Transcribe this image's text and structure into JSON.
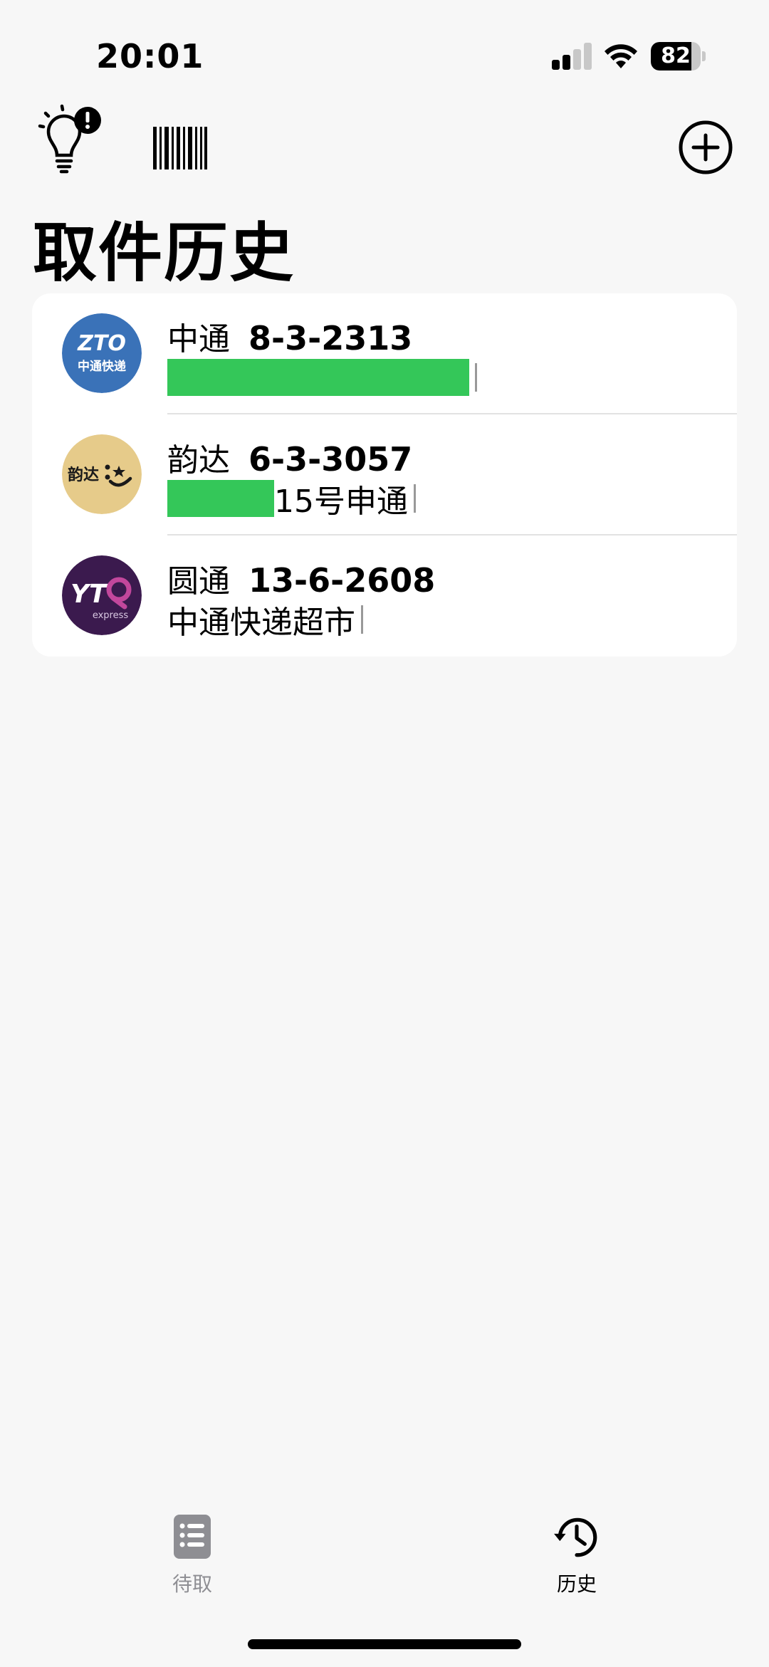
{
  "status_bar": {
    "time": "20:01",
    "battery_level": "82",
    "signal_bars": 2,
    "icons": [
      "cellular-signal-icon",
      "wifi-icon",
      "battery-icon"
    ]
  },
  "toolbar": {
    "icons": [
      "lightbulb-alert-icon",
      "barcode-icon",
      "add-circle-icon"
    ]
  },
  "page": {
    "title": "取件历史"
  },
  "history": {
    "items": [
      {
        "company": "中通",
        "code": "8-3-2313",
        "location": "",
        "logo": "zto-logo",
        "logo_text": "中通快递",
        "logo_color": "#3a72b8"
      },
      {
        "company": "韵达",
        "code": "6-3-3057",
        "location": "15号申通",
        "logo": "yunda-logo",
        "logo_text": "韵达",
        "logo_color": "#e6cb8a"
      },
      {
        "company": "圆通",
        "code": "13-6-2608",
        "location": "中通快递超市",
        "logo": "yto-logo",
        "logo_text": "express",
        "logo_color": "#3b1a4e"
      }
    ]
  },
  "tabbar": {
    "tabs": [
      {
        "label": "待取",
        "icon": "list-icon",
        "active": false
      },
      {
        "label": "历史",
        "icon": "history-clock-icon",
        "active": true
      }
    ]
  },
  "colors": {
    "background": "#f7f7f7",
    "card": "#ffffff",
    "redaction": "#34c759",
    "inactive_tab": "#8e8e93"
  }
}
